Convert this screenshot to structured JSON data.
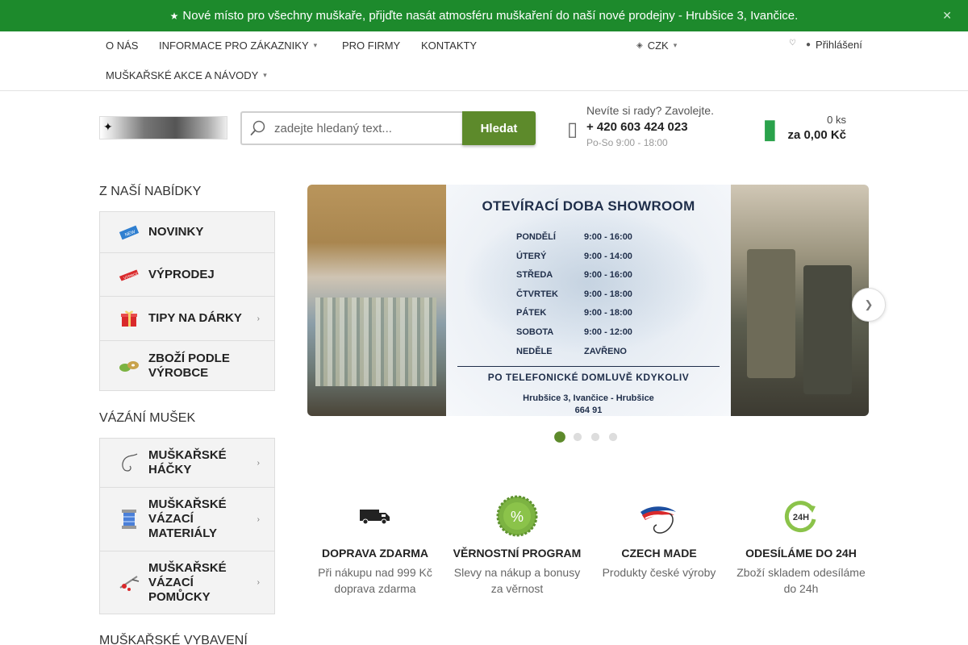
{
  "announcement": {
    "icon": "star-icon",
    "text": "Nové místo pro všechny muškaře, přijďte nasát atmosféru muškaření do naší nové prodejny - Hrubšice 3, Ivančice.",
    "close_icon": "close-icon"
  },
  "nav": {
    "items": [
      "O NÁS",
      "INFORMACE PRO ZÁKAZNIKY",
      "PRO FIRMY",
      "KONTAKTY",
      "MUŠKAŘSKÉ AKCE A NÁVODY"
    ],
    "currency": "CZK",
    "login": "Přihlášení"
  },
  "search": {
    "placeholder": "zadejte hledaný text...",
    "button": "Hledat"
  },
  "contact": {
    "question": "Nevíte si rady? Zavolejte.",
    "phone": "+ 420 603 424 023",
    "hours": "Po-So 9:00 - 18:00"
  },
  "cart": {
    "count": "0 ks",
    "total": "za 0,00 Kč"
  },
  "sidebar": {
    "sections": [
      {
        "title": "Z NAŠÍ NABÍDKY",
        "items": [
          {
            "label": "NOVINKY",
            "icon": "new-badge-icon",
            "has_children": false
          },
          {
            "label": "VÝPRODEJ",
            "icon": "sale-badge-icon",
            "has_children": false
          },
          {
            "label": "TIPY NA DÁRKY",
            "icon": "gift-icon",
            "has_children": true
          },
          {
            "label": "ZBOŽÍ PODLE VÝROBCE",
            "icon": "spools-icon",
            "has_children": false
          }
        ]
      },
      {
        "title": "VÁZÁNÍ MUŠEK",
        "items": [
          {
            "label": "MUŠKAŘSKÉ HÁČKY",
            "icon": "hook-icon",
            "has_children": true
          },
          {
            "label": "MUŠKAŘSKÉ VÁZACÍ MATERIÁLY",
            "icon": "thread-spool-icon",
            "has_children": true
          },
          {
            "label": "MUŠKAŘSKÉ VÁZACÍ POMŮCKY",
            "icon": "vise-tool-icon",
            "has_children": true
          }
        ]
      },
      {
        "title": "MUŠKAŘSKÉ VYBAVENÍ",
        "items": []
      }
    ]
  },
  "banner": {
    "title": "OTEVÍRACÍ DOBA SHOWROOM",
    "schedule": [
      {
        "day": "PONDĚLÍ",
        "time": "9:00 - 16:00"
      },
      {
        "day": "ÚTERÝ",
        "time": "9:00 - 14:00"
      },
      {
        "day": "STŘEDA",
        "time": "9:00 - 16:00"
      },
      {
        "day": "ČTVRTEK",
        "time": "9:00 - 18:00"
      },
      {
        "day": "PÁTEK",
        "time": "9:00 - 18:00"
      },
      {
        "day": "SOBOTA",
        "time": "9:00 - 12:00"
      },
      {
        "day": "NEDĚLE",
        "time": "ZAVŘENO"
      }
    ],
    "note": "PO TELEFONICKÉ DOMLUVĚ KDYKOLIV",
    "address_line1": "Hrubšice 3, Ivančice - Hrubšice",
    "address_line2": "664 91",
    "slides": 4,
    "active_slide": 1
  },
  "benefits": [
    {
      "title": "DOPRAVA ZDARMA",
      "text": "Při nákupu nad 999 Kč doprava zdarma",
      "icon": "truck-icon"
    },
    {
      "title": "VĚRNOSTNÍ PROGRAM",
      "text": "Slevy na nákup a bonusy za věrnost",
      "icon": "percent-badge-icon"
    },
    {
      "title": "CZECH MADE",
      "text": "Produkty české výroby",
      "icon": "czech-fly-icon"
    },
    {
      "title": "ODESÍLÁME DO 24H",
      "text": "Zboží skladem odesíláme do 24h",
      "icon": "clock-24h-icon"
    }
  ],
  "colors": {
    "topbar": "#1d8a2c",
    "accent": "#5d8a2b",
    "cart": "#2aa24b"
  }
}
